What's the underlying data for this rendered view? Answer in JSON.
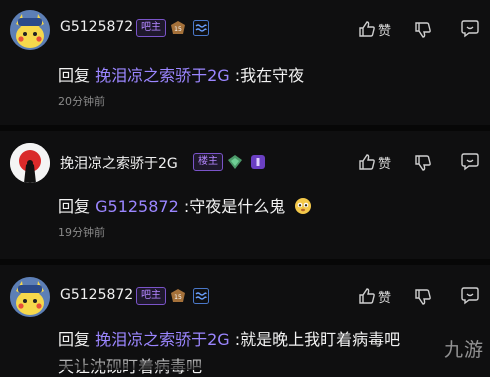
{
  "comments": [
    {
      "username": "G5125872",
      "badge": "吧主",
      "reply_prefix": "回复",
      "mention": "挽泪凉之索骄于2G",
      "text": " :我在守夜",
      "time": "20分钟前",
      "like_label": "赞"
    },
    {
      "username": "挽泪凉之索骄于2G",
      "badge": "楼主",
      "reply_prefix": "回复",
      "mention": "G5125872",
      "text": " :守夜是什么鬼",
      "time": "19分钟前",
      "like_label": "赞"
    },
    {
      "username": "G5125872",
      "badge": "吧主",
      "reply_prefix": "回复",
      "mention": "挽泪凉之索骄于2G",
      "text": " :就是晚上我盯着病毒吧",
      "text_line2": "天让沈砚盯着病毒吧",
      "like_label": "赞"
    }
  ],
  "watermark": "九游",
  "colors": {
    "mention": "#9b86ff",
    "badge": "#b486ff",
    "background": "#0f0f10"
  },
  "icons": [
    "like-icon",
    "dislike-icon",
    "reply-icon",
    "level-icon",
    "wave-badge-icon",
    "emoji-icon"
  ]
}
